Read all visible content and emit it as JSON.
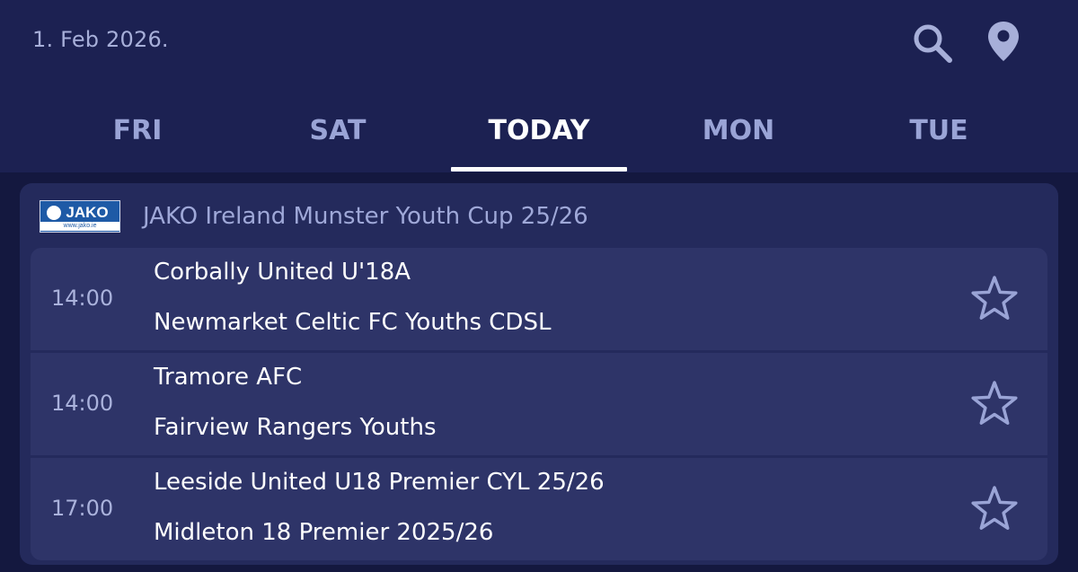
{
  "header": {
    "date": "1. Feb 2026.",
    "icons": {
      "search": "search-icon",
      "location": "location-pin-icon"
    }
  },
  "tabs": [
    {
      "label": "FRI",
      "active": false
    },
    {
      "label": "SAT",
      "active": false
    },
    {
      "label": "TODAY",
      "active": true
    },
    {
      "label": "MON",
      "active": false
    },
    {
      "label": "TUE",
      "active": false
    }
  ],
  "league": {
    "name": "JAKO Ireland Munster Youth Cup 25/26",
    "logo_text": "JAKO",
    "logo_url_text": "www.jako.ie"
  },
  "matches": [
    {
      "time": "14:00",
      "home": "Corbally United U'18A",
      "away": "Newmarket Celtic FC Youths CDSL",
      "favorite_icon": "star-outline-icon"
    },
    {
      "time": "14:00",
      "home": "Tramore AFC",
      "away": "Fairview Rangers Youths",
      "favorite_icon": "star-outline-icon"
    },
    {
      "time": "17:00",
      "home": "Leeside United U18 Premier CYL 25/26",
      "away": "Midleton 18 Premier 2025/26",
      "favorite_icon": "star-outline-icon"
    }
  ],
  "colors": {
    "header_bg": "#1c2152",
    "card_bg": "#242a5c",
    "row_bg": "#2e3468",
    "accent_text": "#9fa8d8",
    "active_tab": "#ffffff"
  }
}
